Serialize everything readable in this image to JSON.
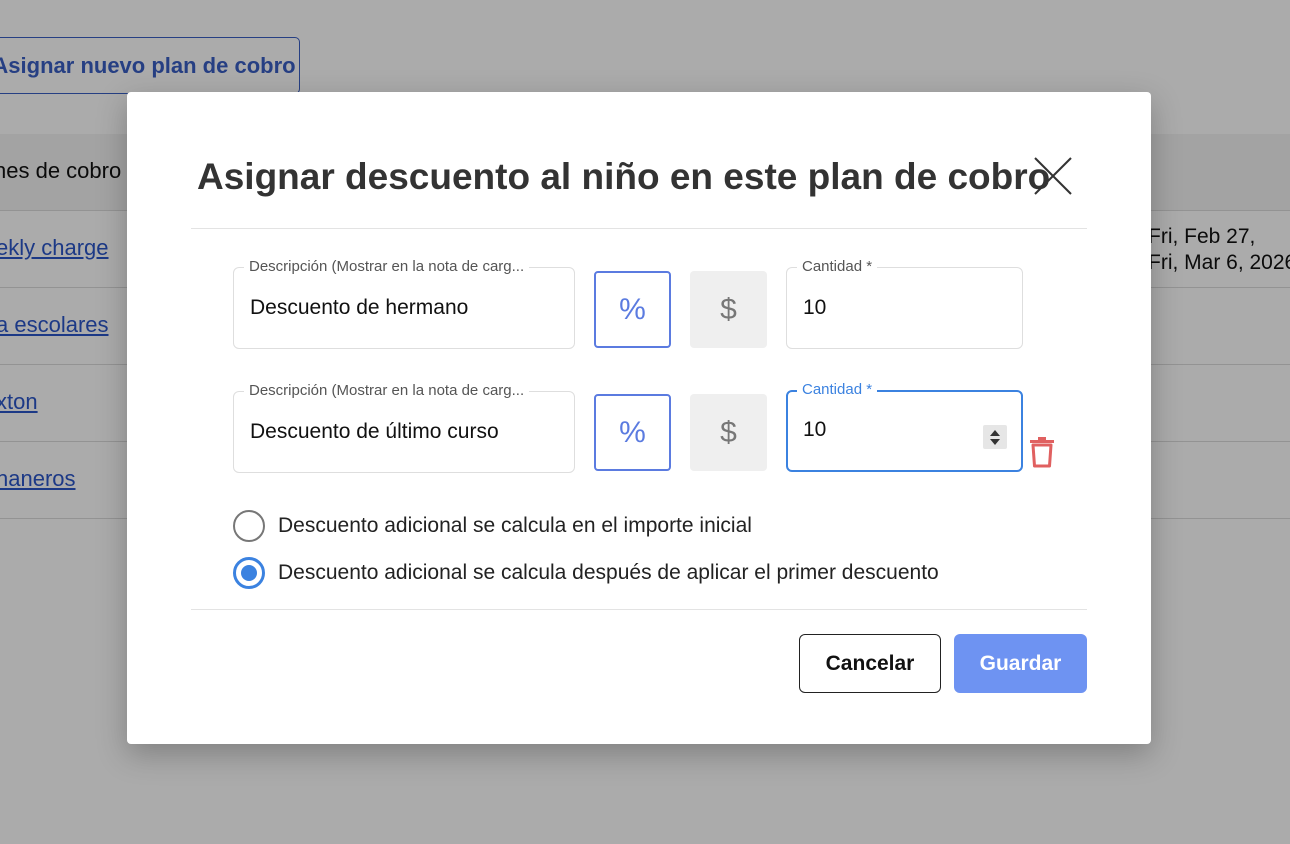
{
  "background": {
    "assign_plan_button": "Asignar nuevo plan de cobro",
    "table_header": "nes de cobro",
    "rows": [
      "ekly charge",
      "a escolares",
      "xton",
      "naneros"
    ],
    "dates": [
      "Fri, Feb 27,",
      "Fri, Mar 6, 2026"
    ]
  },
  "modal": {
    "title": "Asignar descuento al niño en este plan de cobro",
    "close_icon": "close-icon",
    "discounts": [
      {
        "description_label": "Descripción (Mostrar en la nota de carg...",
        "description_value": "Descuento de hermano",
        "percent_label": "%",
        "dollar_label": "$",
        "amount_label": "Cantidad *",
        "amount_value": "10",
        "selected_type": "percent"
      },
      {
        "description_label": "Descripción (Mostrar en la nota de carg...",
        "description_value": "Descuento de último curso",
        "percent_label": "%",
        "dollar_label": "$",
        "amount_label": "Cantidad *",
        "amount_value": "10",
        "selected_type": "percent",
        "focused": true,
        "delete_icon": "trash-icon"
      }
    ],
    "calculation_options": [
      {
        "label": "Descuento adicional se calcula en el importe inicial",
        "checked": false
      },
      {
        "label": "Descuento adicional se calcula después de aplicar el primer descuento",
        "checked": true
      }
    ],
    "cancel_label": "Cancelar",
    "save_label": "Guardar"
  },
  "colors": {
    "accent": "#3b82e0",
    "toggle_active": "#5b7be0",
    "save_button": "#6e93f2",
    "delete_icon": "#e06060",
    "link": "#2b55c8"
  }
}
